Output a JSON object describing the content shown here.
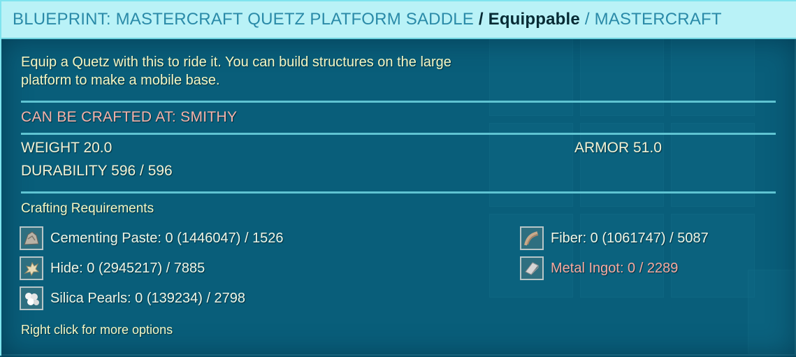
{
  "header": {
    "blueprint_label": "BLUEPRINT: MASTERCRAFT QUETZ PLATFORM SADDLE",
    "sep1": " / ",
    "type_label": "Equippable",
    "sep2": " / ",
    "quality_label": "MASTERCRAFT"
  },
  "description": {
    "line1": "Equip a Quetz with this to ride it.  You can build structures on the large",
    "line2": "platform to make a mobile base."
  },
  "crafted_at": "CAN BE CRAFTED AT: SMITHY",
  "stats": {
    "weight": "WEIGHT 20.0",
    "armor": "ARMOR 51.0",
    "durability": "DURABILITY 596 / 596"
  },
  "requirements": {
    "title": "Crafting Requirements",
    "items": [
      {
        "label": "Cementing Paste: 0 (1446047) / 1526",
        "icon": "cementing-paste-icon"
      },
      {
        "label": "Hide: 0 (2945217) / 7885",
        "icon": "hide-icon"
      },
      {
        "label": "Silica Pearls: 0 (139234) / 2798",
        "icon": "silica-pearls-icon"
      },
      {
        "label": "Fiber: 0 (1061747) / 5087",
        "icon": "fiber-icon"
      },
      {
        "label": "Metal Ingot: 0 / 2289",
        "icon": "metal-ingot-icon",
        "missing": true
      }
    ]
  },
  "footer": "Right click for more options",
  "colors": {
    "header_bg": "#b9f2f7",
    "header_blue": "#2a8aa8",
    "accent_text": "#f4f7c4",
    "warning_text": "#f5b3aa",
    "panel_bg": "#0e5a72"
  }
}
